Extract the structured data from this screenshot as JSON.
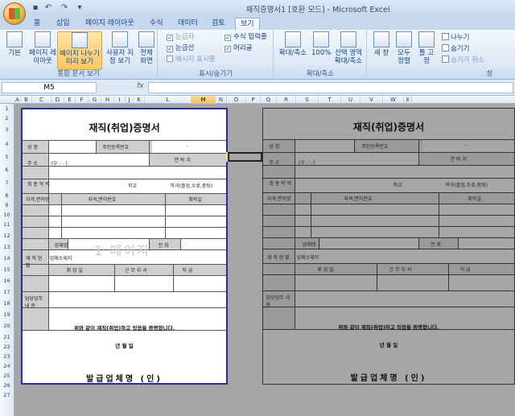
{
  "window": {
    "title": "재직증명서1 [호환 모드] - Microsoft Excel"
  },
  "tabs": [
    "홈",
    "삽입",
    "페이지 레이아웃",
    "수식",
    "데이터",
    "검토",
    "보기"
  ],
  "ribbon": {
    "workbook_views": {
      "label": "통합 문서 보기",
      "buttons": [
        "기본",
        "페이지 레이아웃",
        "페이지 나누기 미리 보기",
        "사용자 지정 보기",
        "전체 화면"
      ]
    },
    "show_hide": {
      "label": "표시/숨기기",
      "items": [
        {
          "label": "눈금자",
          "checked": true,
          "disabled": true
        },
        {
          "label": "수식 입력줄",
          "checked": true,
          "disabled": false
        },
        {
          "label": "눈금선",
          "checked": true,
          "disabled": false
        },
        {
          "label": "머리글",
          "checked": true,
          "disabled": false
        },
        {
          "label": "메시지 표시줄",
          "checked": false,
          "disabled": true
        }
      ]
    },
    "zoom": {
      "label": "확대/축소",
      "buttons": [
        "확대/축소",
        "100%",
        "선택 영역 확대/축소"
      ]
    },
    "window": {
      "label": "창",
      "buttons": [
        "새 창",
        "모두 정렬",
        "틀 고정"
      ],
      "small": [
        "나누기",
        "숨기기",
        "숨기기 취소"
      ]
    }
  },
  "formula_bar": {
    "name_box": "M5",
    "fx": "fx",
    "value": ""
  },
  "columns": [
    "A",
    "B",
    "C",
    "D",
    "E",
    "F",
    "G",
    "H",
    "I",
    "J",
    "K",
    "L",
    "M",
    "N",
    "O",
    "P",
    "Q",
    "R",
    "S",
    "T",
    "U",
    "V",
    "W",
    "X"
  ],
  "selected_column": "M",
  "rows": [
    "1",
    "2",
    "3",
    "4",
    "5",
    "6",
    "7",
    "8",
    "9",
    "10",
    "11",
    "12",
    "13",
    "14",
    "15",
    "16",
    "17",
    "18",
    "19",
    "20",
    "21",
    "22",
    "23",
    "24",
    "25",
    "26",
    "27"
  ],
  "form": {
    "title": "재직(취업)증명서",
    "name_label": "성 명",
    "id_label": "주민등록번호",
    "id_value": "-",
    "address_label": "주 소",
    "address_value": "(우 : - )",
    "phone_label": "연 락 처",
    "school_label": "최 종 학 력",
    "school_suffix": "학교",
    "degree_suffix": "학과(졸업,수료,중퇴)",
    "license_label": "자격,면허명",
    "license_no_label": "자격,면허번호",
    "acquired_label": "취득일",
    "company_label": "업체명",
    "company_phone_label": "전 화",
    "company_addr_label": "업체소재지",
    "employment_label": "재 직 현 황",
    "period_label": "취 업 일",
    "dept_label": "근 무 부 서",
    "position_label": "직 급",
    "duty_label": "담당업무 내 용",
    "confirm_text": "위와 같이 재직(취업)하고 있음을 증명합니다.",
    "date_text": "년 월 일",
    "issuer": "발급업체명",
    "seal": "(인)",
    "watermark": "1 페이지"
  }
}
